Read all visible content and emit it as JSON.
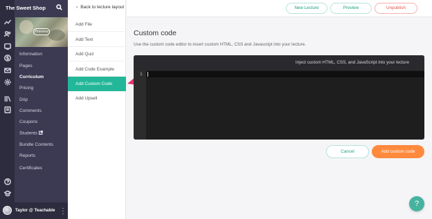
{
  "rail": {
    "icons": [
      "analytics-icon",
      "users-icon",
      "site-icon",
      "sales-icon",
      "email-icon",
      "settings-icon",
      "library-icon",
      "courses-icon",
      "help-icon",
      "graduation-icon"
    ]
  },
  "sidebar": {
    "school_name": "The Sweet Shop",
    "preview_label": "Preview",
    "items": [
      {
        "label": "Information",
        "active": false
      },
      {
        "label": "Pages",
        "active": false
      },
      {
        "label": "Curriculum",
        "active": true
      },
      {
        "label": "Pricing",
        "active": false
      },
      {
        "label": "Drip",
        "active": false
      },
      {
        "label": "Comments",
        "active": false
      },
      {
        "label": "Coupons",
        "active": false
      },
      {
        "label": "Students",
        "active": false,
        "external": true
      },
      {
        "label": "Bundle Contents",
        "active": false
      },
      {
        "label": "Reports",
        "active": false
      },
      {
        "label": "Certificates",
        "active": false
      }
    ],
    "user_name": "Taylor @ Teachable"
  },
  "layout_panel": {
    "back_label": "Back to lecture layout",
    "items": [
      {
        "label": "Add File",
        "active": false
      },
      {
        "label": "Add Text",
        "active": false
      },
      {
        "label": "Add Quiz",
        "active": false
      },
      {
        "label": "Add Code Example",
        "active": false
      },
      {
        "label": "Add Custom Code",
        "active": true
      },
      {
        "label": "Add Upsell",
        "active": false
      }
    ]
  },
  "header": {
    "new_lecture": "New Lecture",
    "preview": "Preview",
    "unpublish": "Unpublish"
  },
  "main": {
    "title": "Custom code",
    "description": "Use the custom code editor to insert custom HTML, CSS and Javascript into your lecture.",
    "editor_hint": "Inject custom HTML, CSS, and JavaScript into your lecture",
    "line_number": "1",
    "cancel_label": "Cancel",
    "add_label": "Add custom code"
  },
  "help_label": "?",
  "colors": {
    "accent": "#23b79a",
    "sidebar": "#3b3a52",
    "rail": "#2d2c3e",
    "primary_action": "#ff8a3d",
    "danger": "#e3524a",
    "pointer": "#e8316c"
  }
}
